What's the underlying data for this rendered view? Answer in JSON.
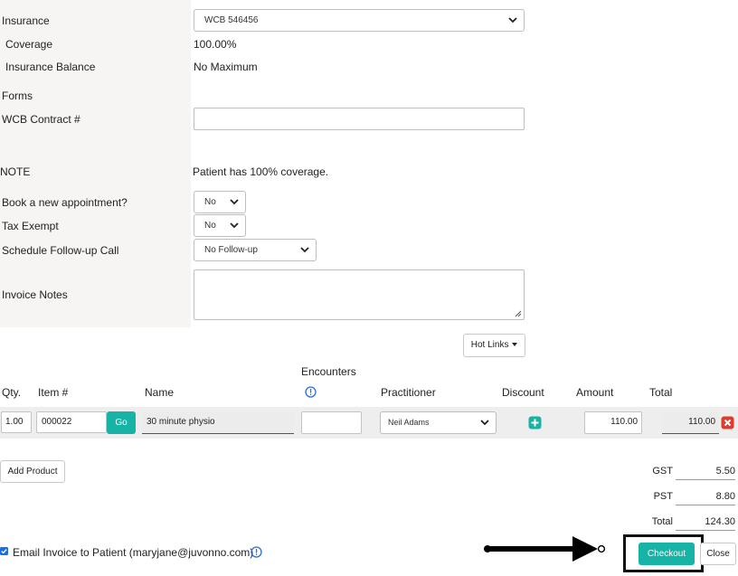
{
  "form": {
    "insurance_label": "Insurance",
    "insurance_value": "WCB 546456",
    "coverage_label": "Coverage",
    "coverage_value": "100.00%",
    "balance_label": "Insurance Balance",
    "balance_value": "No Maximum",
    "forms_label": "Forms",
    "contract_label": "WCB Contract #",
    "contract_value": "",
    "note_label": "NOTE",
    "note_value": "Patient has 100% coverage.",
    "book_label": "Book a new appointment?",
    "book_value": "No",
    "tax_label": "Tax Exempt",
    "tax_value": "No",
    "followup_label": "Schedule Follow-up Call",
    "followup_value": "No Follow-up",
    "notes_label": "Invoice Notes",
    "notes_value": ""
  },
  "hotlinks_label": "Hot Links",
  "table": {
    "headers": {
      "qty": "Qty.",
      "item": "Item #",
      "name": "Name",
      "encounters": "Encounters",
      "practitioner": "Practitioner",
      "discount": "Discount",
      "amount": "Amount",
      "total": "Total"
    },
    "row": {
      "qty": "1.00",
      "item": "000022",
      "go": "Go",
      "name": "30 minute physio",
      "encounters": "",
      "practitioner": "Neil Adams",
      "amount": "110.00",
      "total": "110.00"
    }
  },
  "add_product_label": "Add Product",
  "summary": {
    "gst_label": "GST",
    "gst_value": "5.50",
    "pst_label": "PST",
    "pst_value": "8.80",
    "total_label": "Total",
    "total_value": "124.30"
  },
  "email": {
    "checked": true,
    "label": "Email Invoice to Patient (maryjane@juvonno.com)"
  },
  "checkout_label": "Checkout",
  "close_label": "Close",
  "colors": {
    "accent": "#17b3a6",
    "panel": "#f6f5f3",
    "danger": "#e03b2b"
  }
}
